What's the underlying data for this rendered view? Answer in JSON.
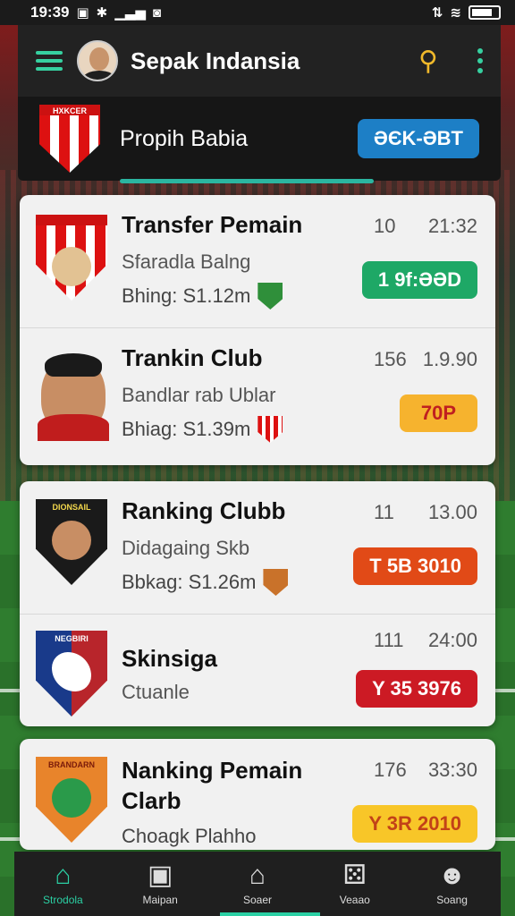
{
  "status_bar": {
    "time": "19:39"
  },
  "header": {
    "title": "Sepak Indansia"
  },
  "banner": {
    "club_name": "Propih Babia",
    "shield_text": "HXKCER",
    "button_label": "ƏЄK-ƏBT"
  },
  "cards": [
    {
      "rows": [
        {
          "title": "Transfer Pemain",
          "sub1": "Sfaradla Balng",
          "sub2": "Bhing: S1.12m",
          "num1": "10",
          "num2": "21:32",
          "pill": "1 9f:ƏƏD",
          "pill_style": "green"
        },
        {
          "title": "Trankin Club",
          "sub1": "Bandlar rab Ublar",
          "sub2": "Bhiag: S1.39m",
          "num1": "156",
          "num2": "1.9.90",
          "pill": "70P",
          "pill_style": "orange"
        }
      ]
    },
    {
      "rows": [
        {
          "title": "Ranking Clubb",
          "sub1": "Didagaing Skb",
          "sub2": "Bbkag: S1.26m",
          "num1": "11",
          "num2": "13.00",
          "pill": "T 5B 3010",
          "pill_style": "red-orange",
          "shield_text": "DIONSAIL"
        },
        {
          "title": "Skinsiga",
          "sub1": "Ctuanle",
          "sub2": "",
          "num1": "111",
          "num2": "24:00",
          "pill": "Y 35 3976",
          "pill_style": "red",
          "shield_text": "NEGBIRI"
        }
      ]
    },
    {
      "rows": [
        {
          "title": "Nanking Pemain",
          "title2": "Clarb",
          "sub1": "",
          "sub2": "Choagk Plahho",
          "num1": "176",
          "num2": "33:30",
          "pill": "Y 3R 2010",
          "pill_style": "yellow",
          "shield_text": "BRANDARN"
        }
      ]
    }
  ],
  "bottom_nav": [
    {
      "label": "Strodola",
      "icon": "home-icon",
      "active": true
    },
    {
      "label": "Maipan",
      "icon": "shirt-icon",
      "active": false
    },
    {
      "label": "Soaer",
      "icon": "house-icon",
      "active": false
    },
    {
      "label": "Veaao",
      "icon": "gamepad-icon",
      "active": false
    },
    {
      "label": "Soang",
      "icon": "user-icon",
      "active": false
    }
  ],
  "colors": {
    "accent": "#2bd0a4",
    "brand_blue": "#1d7fc6",
    "card_bg": "#f1f1f1"
  }
}
